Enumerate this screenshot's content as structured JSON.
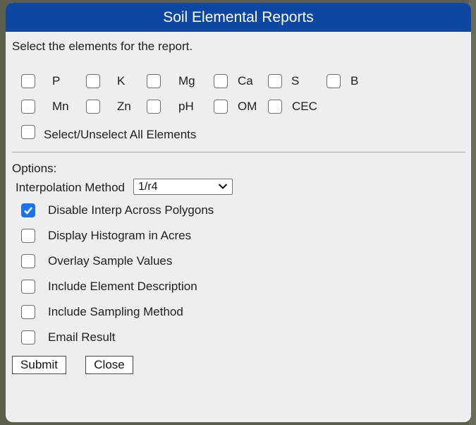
{
  "dialog": {
    "title": "Soil Elemental Reports",
    "instruction": "Select the elements for the report.",
    "elements_row1": [
      "P",
      "K",
      "Mg",
      "Ca",
      "S",
      "B"
    ],
    "elements_row2": [
      "Mn",
      "Zn",
      "pH",
      "OM",
      "CEC"
    ],
    "select_all_label": "Select/Unselect All Elements",
    "options_label": "Options:",
    "interp_label": "Interpolation Method",
    "interp_value": "1/r4",
    "options": [
      {
        "label": "Disable Interp Across Polygons",
        "checked": true
      },
      {
        "label": "Display Histogram in Acres",
        "checked": false
      },
      {
        "label": "Overlay Sample Values",
        "checked": false
      },
      {
        "label": "Include Element Description",
        "checked": false
      },
      {
        "label": "Include Sampling Method",
        "checked": false
      },
      {
        "label": "Email Result",
        "checked": false
      }
    ],
    "submit_label": "Submit",
    "close_label": "Close"
  },
  "colors": {
    "titlebar": "#0d47a1",
    "panel": "#eeeeee",
    "checked": "#1a73e8"
  }
}
